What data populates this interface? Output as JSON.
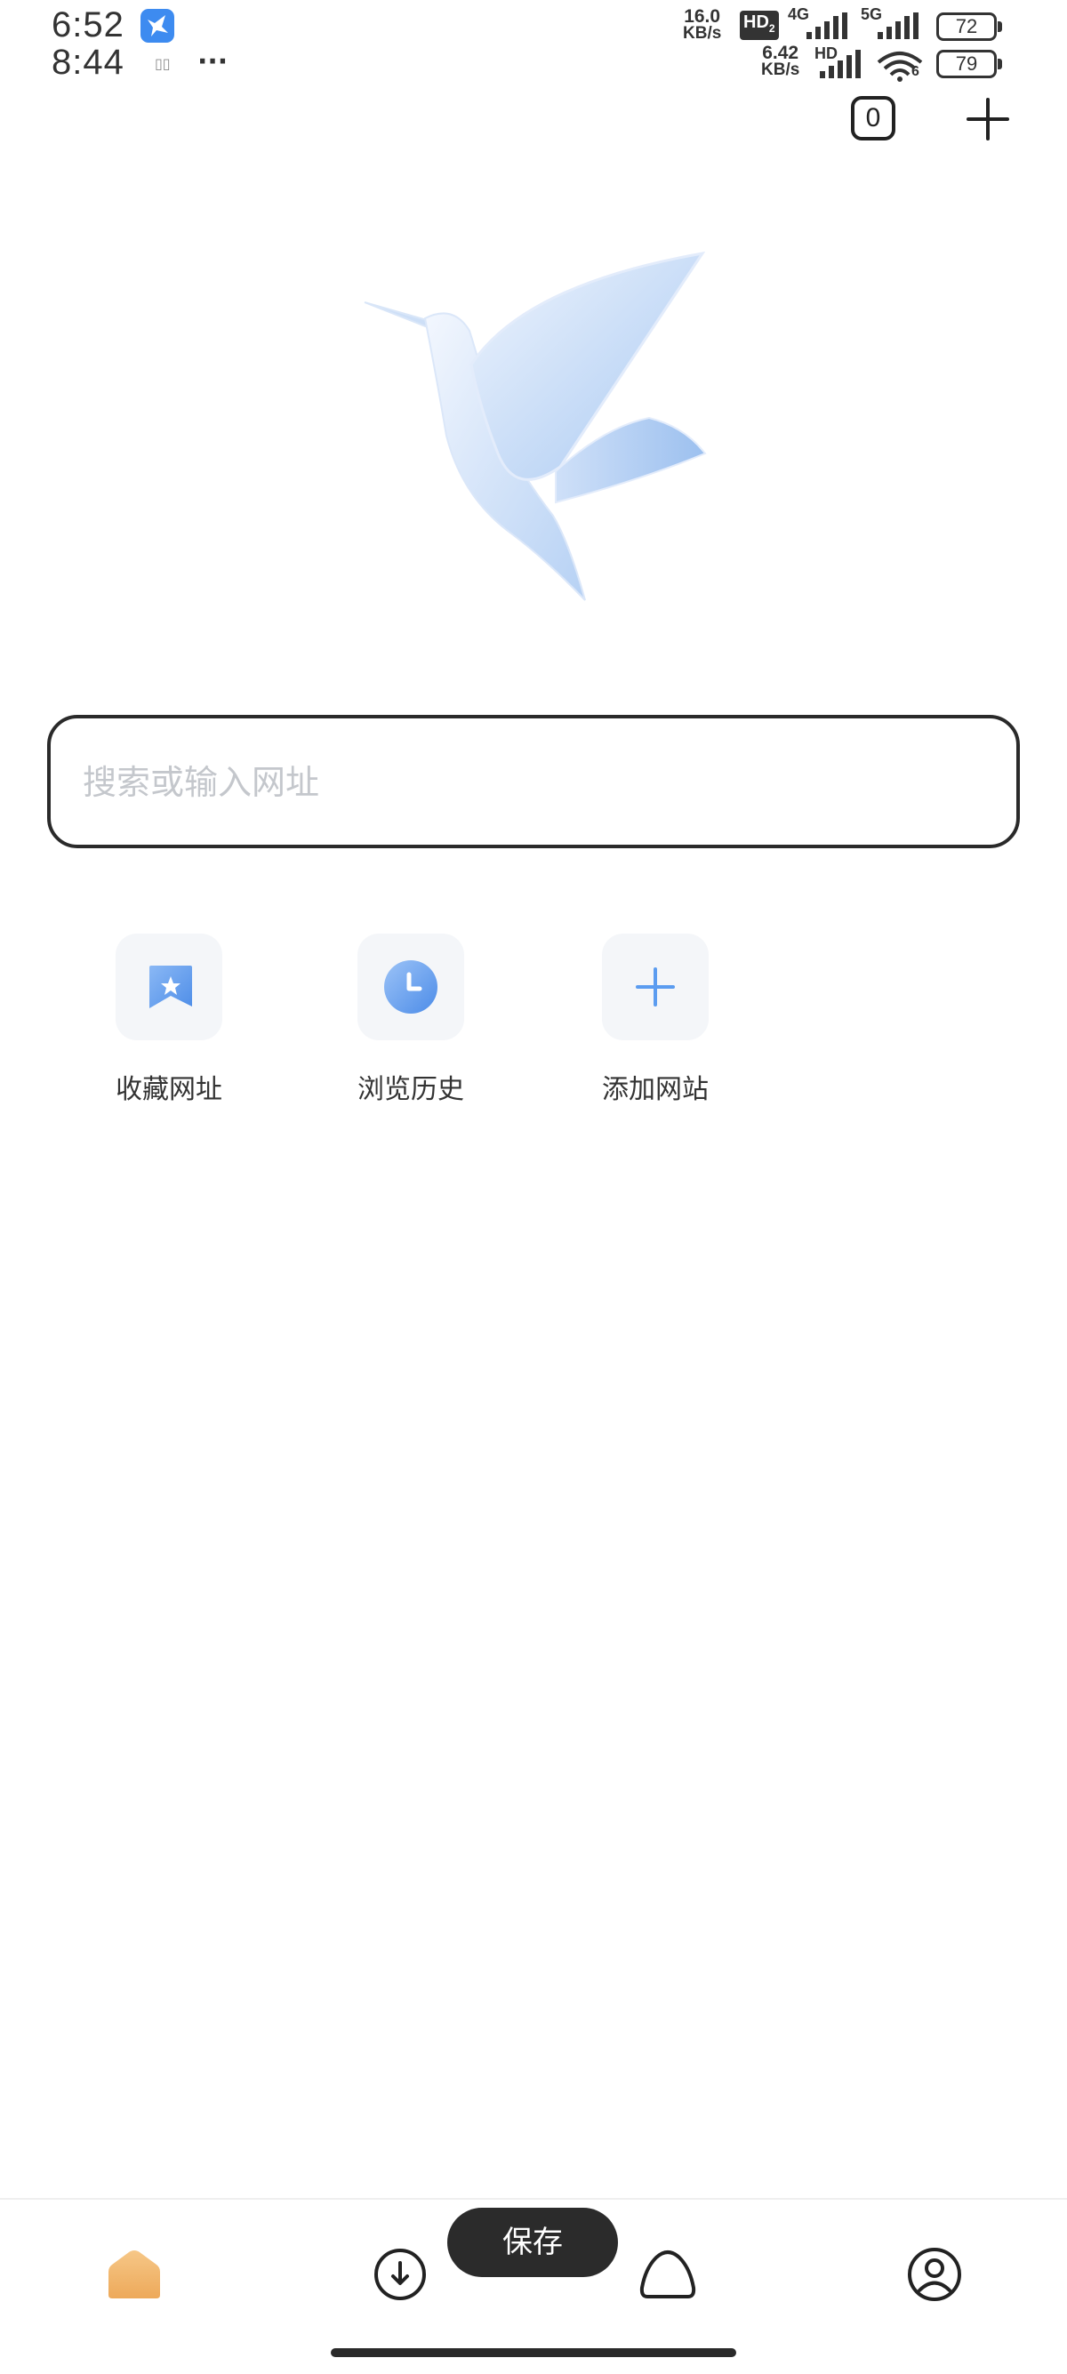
{
  "status_bar": {
    "time_1": "6:52",
    "time_2": "8:44",
    "more_indicator": "···",
    "speed_1_value": "16.0",
    "speed_1_unit": "KB/s",
    "speed_2_value": "6.42",
    "speed_2_unit": "KB/s",
    "hd_badge": "HD",
    "hd_badge_sub": "2",
    "net_4g": "4G",
    "net_5g": "5G",
    "net_hd": "HD",
    "wifi_num": "6",
    "battery_1": "72",
    "battery_2": "79"
  },
  "header": {
    "tab_count": "0",
    "add_tab_icon": "plus-icon"
  },
  "logo": {
    "icon": "hummingbird-logo"
  },
  "search": {
    "placeholder": "搜索或输入网址",
    "value": ""
  },
  "quick_links": [
    {
      "label": "收藏网址",
      "icon": "bookmark-star-icon"
    },
    {
      "label": "浏览历史",
      "icon": "clock-icon"
    },
    {
      "label": "添加网站",
      "icon": "plus-icon"
    }
  ],
  "toast": {
    "label": "保存"
  },
  "bottom_nav": {
    "items": [
      {
        "icon": "home-icon",
        "active": true
      },
      {
        "icon": "download-icon",
        "active": false
      },
      {
        "icon": "cloud-icon",
        "active": false
      },
      {
        "icon": "user-icon",
        "active": false
      }
    ]
  },
  "colors": {
    "accent_blue": "#5b9cf0",
    "home_active": "#f0b56a",
    "tile_bg": "#f4f6f9",
    "placeholder": "#c4c7cc"
  }
}
